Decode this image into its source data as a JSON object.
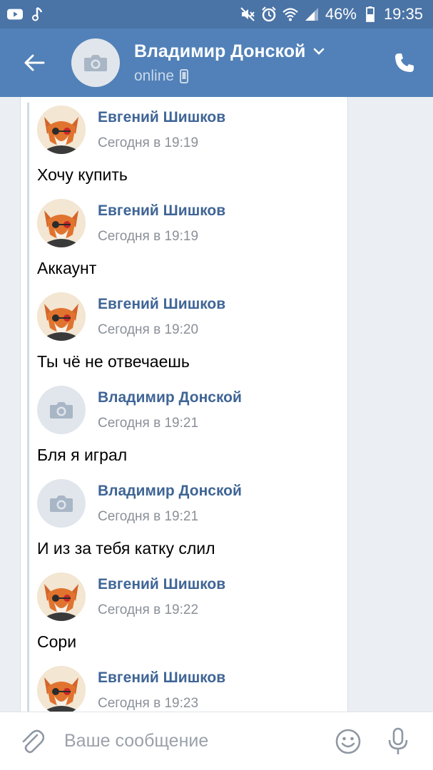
{
  "status_bar": {
    "battery": "46%",
    "time": "19:35"
  },
  "header": {
    "name": "Владимир Донской",
    "status": "online"
  },
  "messages": [
    {
      "author": "Евгений Шишков",
      "time": "Сегодня в 19:19",
      "text": "Хочу купить",
      "avatar": "fox"
    },
    {
      "author": "Евгений Шишков",
      "time": "Сегодня в 19:19",
      "text": "Аккаунт",
      "avatar": "fox"
    },
    {
      "author": "Евгений Шишков",
      "time": "Сегодня в 19:20",
      "text": "Ты чё не отвечаешь",
      "avatar": "fox"
    },
    {
      "author": "Владимир Донской",
      "time": "Сегодня в 19:21",
      "text": "Бля я играл",
      "avatar": "placeholder"
    },
    {
      "author": "Владимир Донской",
      "time": "Сегодня в 19:21",
      "text": "И из за тебя катку слил",
      "avatar": "placeholder"
    },
    {
      "author": "Евгений Шишков",
      "time": "Сегодня в 19:22",
      "text": "Сори",
      "avatar": "fox"
    },
    {
      "author": "Евгений Шишков",
      "time": "Сегодня в 19:23",
      "text": "",
      "avatar": "fox"
    }
  ],
  "composer": {
    "placeholder": "Ваше сообщение"
  },
  "colors": {
    "header": "#5181b8",
    "status_bar": "#4a73a6",
    "author": "#3f6596",
    "chat_bg": "#ebeff3"
  },
  "icons": [
    "youtube-icon",
    "music-note-icon",
    "mute-icon",
    "alarm-icon",
    "wifi-icon",
    "signal-icon",
    "battery-icon",
    "back-arrow-icon",
    "camera-icon",
    "chevron-down-icon",
    "mobile-icon",
    "phone-icon",
    "paperclip-icon",
    "emoji-icon",
    "microphone-icon"
  ]
}
